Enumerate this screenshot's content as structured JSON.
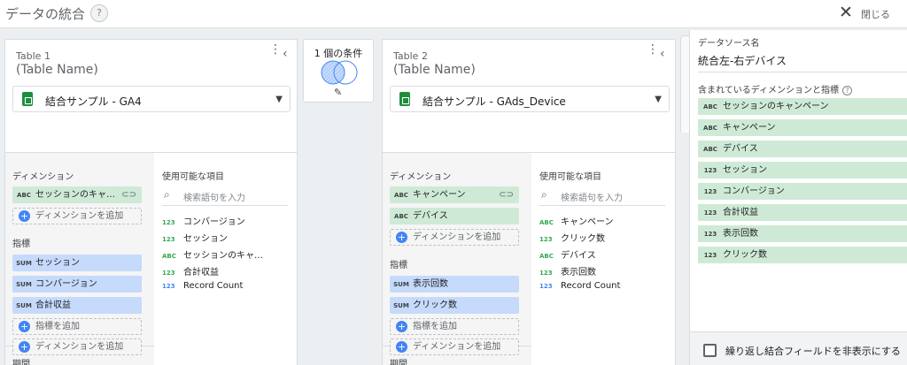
{
  "header": {
    "title": "データの統合",
    "help": "?",
    "close_label": "閉じる"
  },
  "table1": {
    "title": "Table 1",
    "subtitle": "(Table Name)",
    "source": "結合サンプル - GA4",
    "dimensions_title": "ディメンション",
    "dimensions": [
      {
        "tag": "ABC",
        "label": "セッションのキャ…"
      }
    ],
    "add_dimension": "ディメンションを追加",
    "metrics_title": "指標",
    "metrics": [
      {
        "tag": "SUM",
        "label": "セッション"
      },
      {
        "tag": "SUM",
        "label": "コンバージョン"
      },
      {
        "tag": "SUM",
        "label": "合計収益"
      }
    ],
    "add_metric": "指標を追加",
    "period_title": "期間",
    "add_period_dimension": "ディメンションを追加",
    "available_title": "使用可能な項目",
    "search_placeholder": "検索語句を入力",
    "available": [
      {
        "tag": "123",
        "label": "コンバージョン"
      },
      {
        "tag": "123",
        "label": "セッション"
      },
      {
        "tag": "ABC",
        "label": "セッションのキャ…"
      },
      {
        "tag": "123",
        "label": "合計収益"
      },
      {
        "tag": "123",
        "label": "Record Count"
      }
    ]
  },
  "condition": {
    "label": "1 個の条件"
  },
  "table2": {
    "title": "Table 2",
    "subtitle": "(Table Name)",
    "source": "結合サンプル - GAds_Device",
    "dimensions_title": "ディメンション",
    "dimensions": [
      {
        "tag": "ABC",
        "label": "キャンペーン"
      },
      {
        "tag": "ABC",
        "label": "デバイス"
      }
    ],
    "add_dimension": "ディメンションを追加",
    "metrics_title": "指標",
    "metrics": [
      {
        "tag": "SUM",
        "label": "表示回数"
      },
      {
        "tag": "SUM",
        "label": "クリック数"
      }
    ],
    "add_metric": "指標を追加",
    "period_title": "期間",
    "add_period_dimension": "ディメンションを追加",
    "available_title": "使用可能な項目",
    "search_placeholder": "検索語句を入力",
    "available": [
      {
        "tag": "ABC",
        "label": "キャンペーン"
      },
      {
        "tag": "123",
        "label": "クリック数"
      },
      {
        "tag": "ABC",
        "label": "デバイス"
      },
      {
        "tag": "123",
        "label": "表示回数"
      },
      {
        "tag": "123",
        "label": "Record Count"
      }
    ]
  },
  "right_panel": {
    "datasource_label": "データソース名",
    "datasource_name": "統合左-右デバイス",
    "included_label": "含まれているディメンションと指標",
    "included": [
      {
        "tag": "ABC",
        "label": "セッションのキャンペーン"
      },
      {
        "tag": "ABC",
        "label": "キャンペーン"
      },
      {
        "tag": "ABC",
        "label": "デバイス"
      },
      {
        "tag": "123",
        "label": "セッション"
      },
      {
        "tag": "123",
        "label": "コンバージョン"
      },
      {
        "tag": "123",
        "label": "合計収益"
      },
      {
        "tag": "123",
        "label": "表示回数"
      },
      {
        "tag": "123",
        "label": "クリック数"
      }
    ],
    "hide_repeat_label": "繰り返し結合フィールドを非表示にする"
  },
  "colors": {
    "dimension_chip": "#ceead6",
    "metric_chip": "#c6dafc",
    "accent": "#4285f4"
  }
}
